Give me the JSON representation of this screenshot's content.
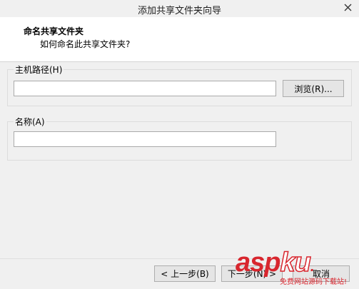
{
  "window": {
    "title": "添加共享文件夹向导",
    "close_icon": "close-icon"
  },
  "header": {
    "title": "命名共享文件夹",
    "subtitle": "如何命名此共享文件夹?"
  },
  "host_path": {
    "label": "主机路径(H)",
    "value": "",
    "browse_label": "浏览(R)..."
  },
  "name": {
    "label": "名称(A)",
    "value": ""
  },
  "footer": {
    "prev_label": "< 上一步(B)",
    "next_label": "下一步(N) >",
    "cancel_label": "取消"
  },
  "watermark": {
    "logo_asp": "asp",
    "logo_ku": "ku",
    "logo_dot": ".",
    "tagline": "免费网站源码下载站!"
  },
  "colors": {
    "watermark": "#d8262e",
    "background": "#f0f0f0",
    "header_bg": "#ffffff"
  }
}
